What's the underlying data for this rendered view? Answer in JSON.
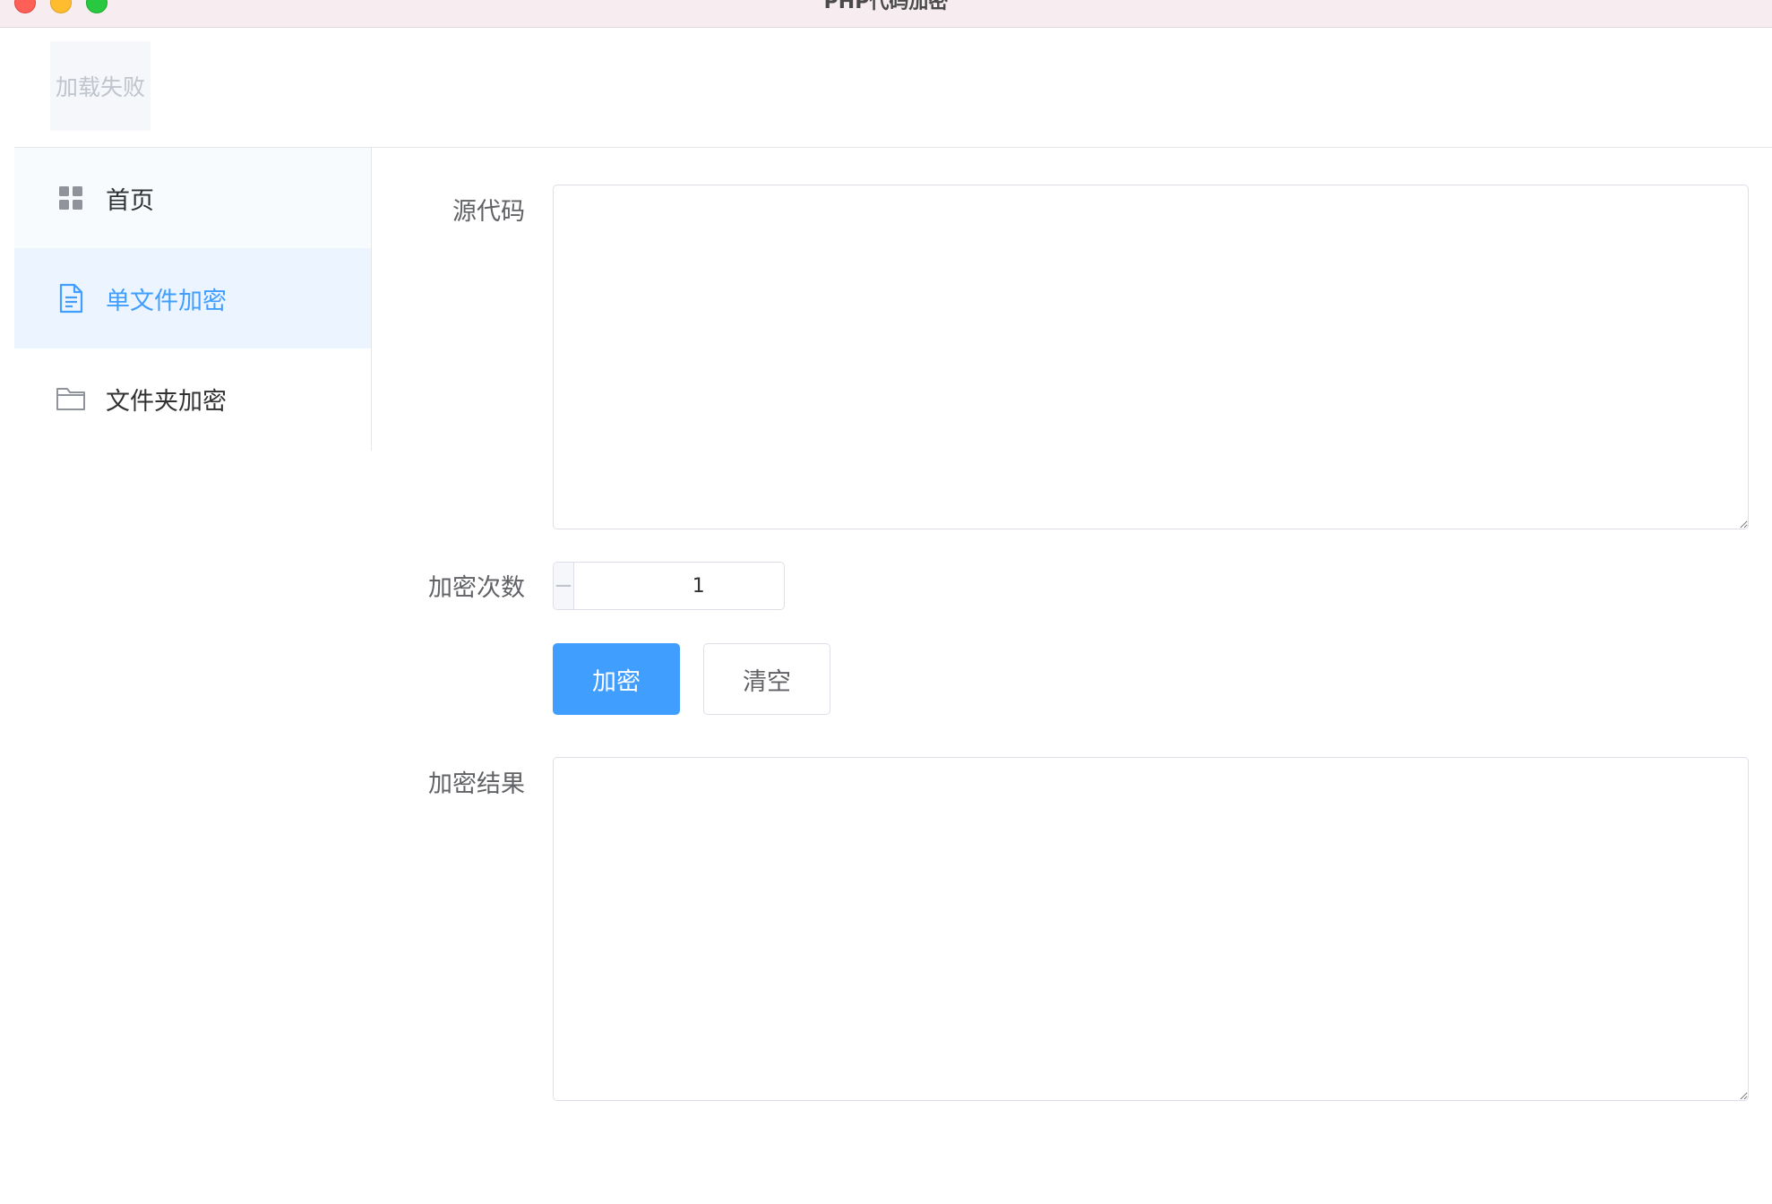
{
  "window": {
    "title": "PHP代码加密"
  },
  "header": {
    "logo_alt": "加载失败"
  },
  "sidebar": {
    "items": [
      {
        "label": "首页",
        "icon": "grid-icon",
        "active": false
      },
      {
        "label": "单文件加密",
        "icon": "document-icon",
        "active": true
      },
      {
        "label": "文件夹加密",
        "icon": "folder-icon",
        "active": false
      }
    ]
  },
  "form": {
    "source_label": "源代码",
    "source_value": "",
    "count_label": "加密次数",
    "count_value": "1",
    "decrement_symbol": "−",
    "increment_symbol": "+",
    "encrypt_button": "加密",
    "clear_button": "清空",
    "result_label": "加密结果",
    "result_value": ""
  },
  "colors": {
    "accent": "#409eff",
    "active_bg": "#ecf5ff",
    "border": "#dcdfe6",
    "label_text": "#606266"
  }
}
